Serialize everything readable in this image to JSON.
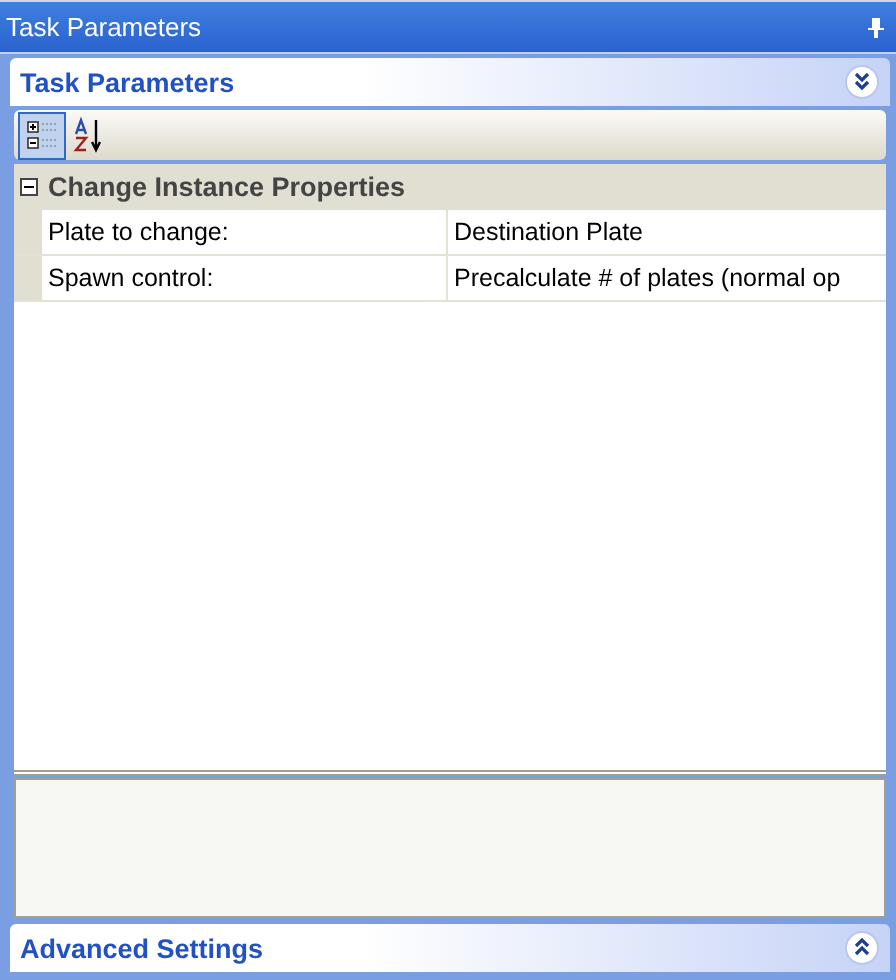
{
  "window": {
    "title": "Task Parameters"
  },
  "panels": [
    {
      "title": "Task Parameters",
      "expanded": true,
      "toolbar": [
        {
          "kind": "categorized",
          "selected": true
        },
        {
          "kind": "alphabetical",
          "selected": false
        }
      ],
      "categories": [
        {
          "title": "Change Instance Properties",
          "expanded": true,
          "properties": [
            {
              "name": "Plate to change:",
              "value": "Destination Plate",
              "selected": false
            },
            {
              "name": "Spawn control:",
              "value": "Precalculate # of plates (normal op",
              "selected": false
            }
          ]
        }
      ]
    },
    {
      "title": "Advanced Settings",
      "expanded": false
    }
  ]
}
